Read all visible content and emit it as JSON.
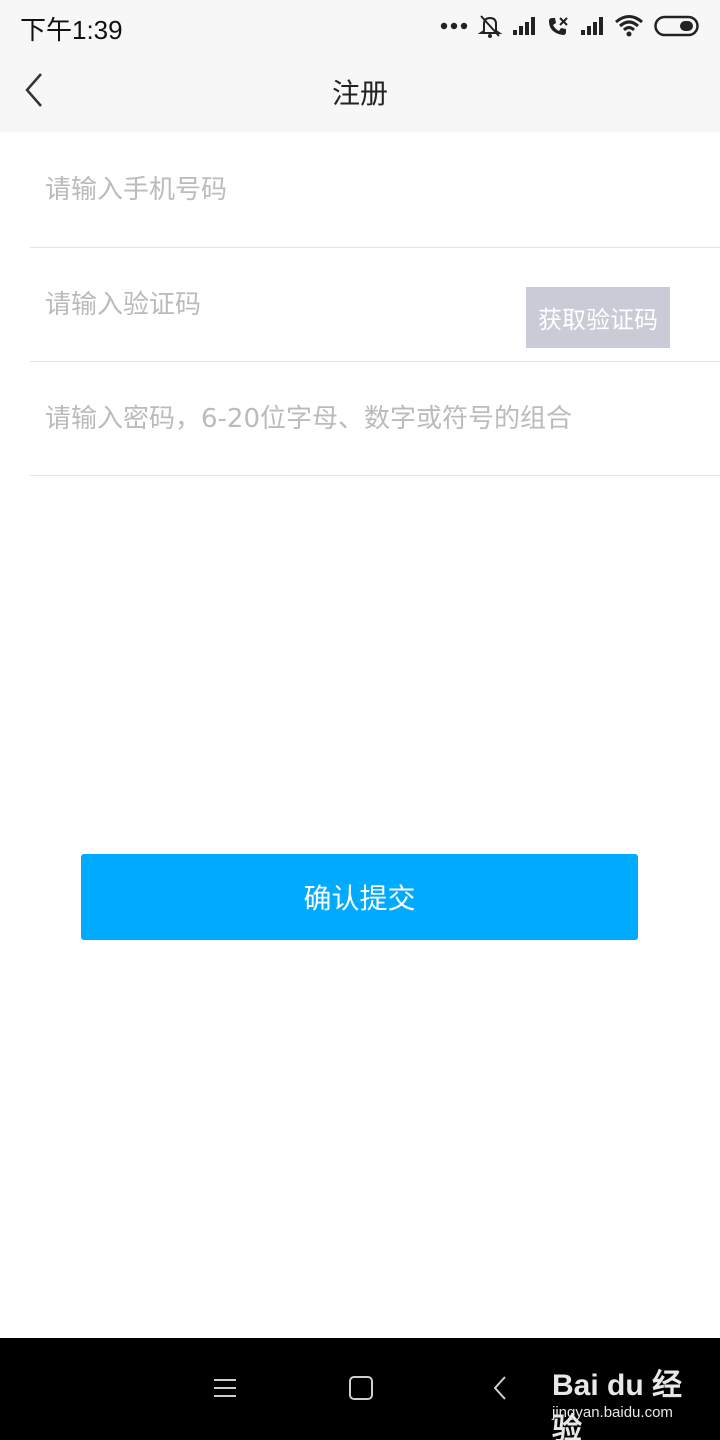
{
  "status_bar": {
    "time": "下午1:39",
    "icons": [
      "more-dots-icon",
      "bell-muted-icon",
      "signal-icon",
      "call-missed-icon",
      "signal-icon",
      "wifi-icon",
      "battery-icon"
    ]
  },
  "header": {
    "title": "注册",
    "back_icon": "chevron-left-icon"
  },
  "form": {
    "phone_placeholder": "请输入手机号码",
    "phone_value": "",
    "code_placeholder": "请输入验证码",
    "code_value": "",
    "get_code_label": "获取验证码",
    "password_placeholder": "请输入密码，6-20位字母、数字或符号的组合",
    "password_value": ""
  },
  "submit_label": "确认提交",
  "colors": {
    "accent": "#00aaff",
    "get_code_bg": "#c9ccd6",
    "header_bg": "#f7f7f7",
    "divider": "#e2e2e2",
    "nav_bg": "#000000"
  },
  "nav_bar": {
    "icons": [
      "menu-icon",
      "home-square-icon",
      "back-triangle-icon"
    ]
  },
  "watermark": {
    "logo": "Bai du 经验",
    "url": "jingyan.baidu.com"
  }
}
